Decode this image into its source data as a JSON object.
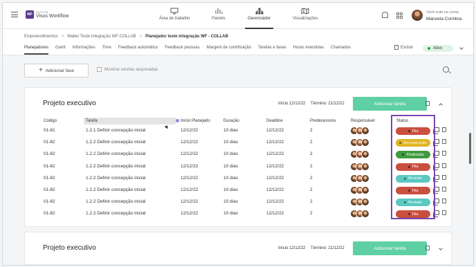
{
  "app": {
    "brand_small": "AUTO BA",
    "brand_name": "Visus Workflow",
    "logo_mark": "WF"
  },
  "nav": [
    {
      "label": "Área de trabalho",
      "icon": "monitor-icon"
    },
    {
      "label": "Painéis",
      "icon": "bar-chart-icon"
    },
    {
      "label": "Gerenciador",
      "icon": "hierarchy-icon"
    },
    {
      "label": "Visualizações",
      "icon": "map-icon"
    }
  ],
  "user": {
    "caption": "Você está na conta",
    "name": "Manoela Coimbra"
  },
  "breadcrumb": {
    "items": [
      "Empreendimentos",
      "Walter Teste integração WF-COLLAB"
    ],
    "current": "Planejador teste integração WF - COLLAB",
    "separator": ">"
  },
  "tabs": [
    "Planejadores",
    "Gantt",
    "Informações",
    "Time",
    "Feedback automático",
    "Feedback pessoas",
    "Margem de contribuição",
    "Tarefas e fases",
    "Horas investidas",
    "Chamados"
  ],
  "header_actions": {
    "delete_label": "Excluir",
    "status_label": "Ativo"
  },
  "actions": {
    "add_phase": "Adicionar fase",
    "show_archived": "Mostrar tarefas arquivadas"
  },
  "phase": {
    "title": "Projeto executivo",
    "start": "Início 12/12/22",
    "end": "Término: 21/12/22",
    "add_task": "Adicionar tarefa",
    "columns": {
      "code": "Código",
      "task": "Tarefa",
      "start": "Início Planejado",
      "duration": "Duração",
      "deadline": "Deadline",
      "predecessor": "Predecessora",
      "responsible": "Responsável",
      "status": "Status"
    },
    "rows": [
      {
        "code": "01-81",
        "task": "1.2.1 Definir concepção inicial",
        "start": "12/12/22",
        "duration": "10 dias",
        "deadline": "12/12/22",
        "pred": "2",
        "status": "Fila"
      },
      {
        "code": "01-82",
        "task": "1.2.2 Definir concepção inicial",
        "start": "12/12/22",
        "duration": "10 dias",
        "deadline": "12/12/22",
        "pred": "2",
        "status": "Em execução"
      },
      {
        "code": "01-82",
        "task": "1.2.2 Definir concepção inicial",
        "start": "12/12/22",
        "duration": "10 dias",
        "deadline": "12/12/22",
        "pred": "2",
        "status": "Finalizada"
      },
      {
        "code": "01-82",
        "task": "1.2.2 Definir concepção inicial",
        "start": "12/12/22",
        "duration": "10 dias",
        "deadline": "12/12/22",
        "pred": "2",
        "status": "Fila"
      },
      {
        "code": "01-82",
        "task": "1.2.2 Definir concepção inicial",
        "start": "12/12/22",
        "duration": "10 dias",
        "deadline": "12/12/22",
        "pred": "2",
        "status": "Revisão"
      },
      {
        "code": "01-82",
        "task": "1.2.2 Definir concepção inicial",
        "start": "12/12/22",
        "duration": "10 dias",
        "deadline": "12/12/22",
        "pred": "2",
        "status": "Fila"
      },
      {
        "code": "01-82",
        "task": "1.2.2 Definir concepção inicial",
        "start": "12/12/22",
        "duration": "10 dias",
        "deadline": "12/12/22",
        "pred": "2",
        "status": "Revisão"
      },
      {
        "code": "01-82",
        "task": "1.2.2 Definir concepção inicial",
        "start": "12/12/22",
        "duration": "10 dias",
        "deadline": "12/12/22",
        "pred": "2",
        "status": "Fila"
      }
    ]
  },
  "phase2": {
    "title": "Projeto executivo",
    "start": "Início 12/12/22",
    "end": "Término: 21/12/22",
    "add_task": "Adicionar tarefa"
  },
  "status_colors": {
    "Fila": {
      "bg": "#c9503f",
      "dot": "#5a2019"
    },
    "Em execução": {
      "bg": "#e0b524",
      "dot": "#7a5a00"
    },
    "Finalizada": {
      "bg": "#3e9a3f",
      "dot": "#1e4f1e"
    },
    "Revisão": {
      "bg": "#5bc8c1",
      "dot": "#2a6f6a"
    }
  },
  "colors": {
    "accent": "#5fd0a4",
    "highlight": "#7a44b0",
    "brand": "#5b3a8c"
  }
}
